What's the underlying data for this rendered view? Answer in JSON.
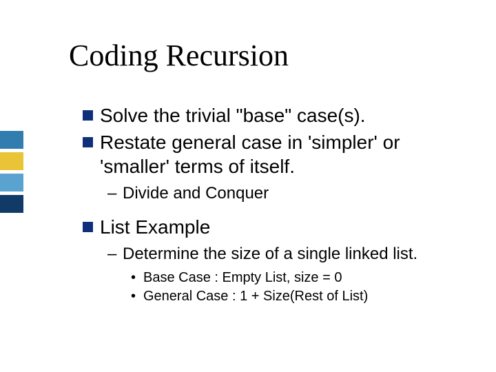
{
  "title": "Coding Recursion",
  "bullets": {
    "b1": "Solve the trivial \"base\" case(s).",
    "b2": "Restate general case in 'simpler' or 'smaller' terms of itself.",
    "b2_sub1": "Divide and Conquer",
    "b3": "List Example",
    "b3_sub1": "Determine the size of a single linked list.",
    "b3_sub1_a": "Base Case :  Empty List, size = 0",
    "b3_sub1_b": "General Case :  1 + Size(Rest of List)"
  }
}
